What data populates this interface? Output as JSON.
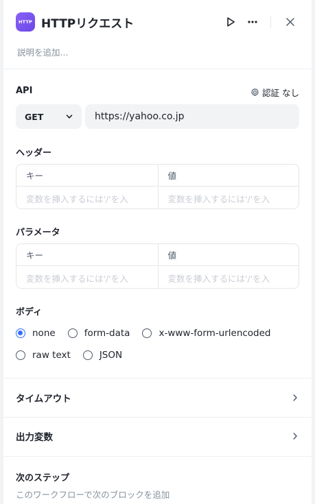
{
  "header": {
    "icon_text": "HTTP",
    "title": "HTTPリクエスト",
    "description_placeholder": "説明を追加..."
  },
  "api": {
    "label": "API",
    "auth_label": "認証 なし",
    "method": "GET",
    "url": "https://yahoo.co.jp"
  },
  "headers": {
    "label": "ヘッダー",
    "col_key": "キー",
    "col_value": "値",
    "key_placeholder": "変数を挿入するには'/'を入",
    "value_placeholder": "変数を挿入するには'/'を入"
  },
  "params": {
    "label": "パラメータ",
    "col_key": "キー",
    "col_value": "値",
    "key_placeholder": "変数を挿入するには'/'を入",
    "value_placeholder": "変数を挿入するには'/'を入"
  },
  "body": {
    "label": "ボディ",
    "selected": "none",
    "options": [
      "none",
      "form-data",
      "x-www-form-urlencoded",
      "raw text",
      "JSON"
    ]
  },
  "timeout": {
    "label": "タイムアウト"
  },
  "output": {
    "label": "出力変数"
  },
  "next_step": {
    "label": "次のステップ",
    "subtitle": "このワークフローで次のブロックを追加"
  },
  "colors": {
    "accent": "#3370ff",
    "icon_bg": "#7b55f0"
  }
}
